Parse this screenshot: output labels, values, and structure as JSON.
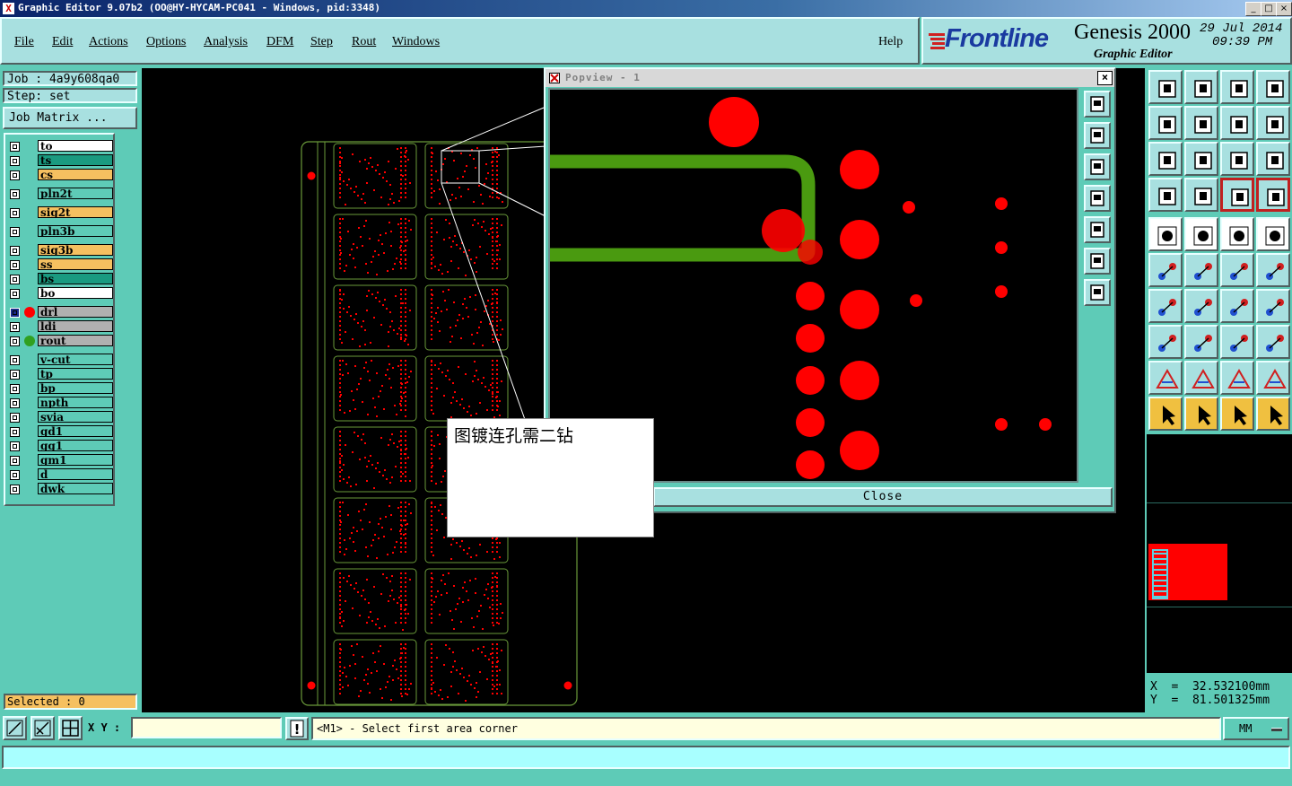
{
  "window": {
    "title": "Graphic Editor 9.07b2 (OO@HY-HYCAM-PC041 - Windows, pid:3348)",
    "controls": [
      "_",
      "□",
      "×"
    ]
  },
  "menu": {
    "items": [
      "File",
      "Edit",
      "Actions",
      "Options",
      "Analysis",
      "DFM",
      "Step",
      "Rout",
      "Windows"
    ],
    "help": "Help"
  },
  "brand": {
    "logo": "Frontline",
    "product": "Genesis 2000",
    "subtitle": "Graphic Editor",
    "date": "29 Jul 2014",
    "time": "09:39 PM"
  },
  "job": {
    "job_label": "Job : 4a9y608qa0",
    "step_label": "Step: set",
    "matrix_button": "Job Matrix ..."
  },
  "layers": [
    {
      "name": "to",
      "color": "#ffffff"
    },
    {
      "name": "ts",
      "color": "#1a9a80"
    },
    {
      "name": "cs",
      "color": "#f5c060"
    },
    {
      "name": "pln2t",
      "color": "#5ecbb7"
    },
    {
      "name": "sig2t",
      "color": "#f5c060"
    },
    {
      "name": "pln3b",
      "color": "#5ecbb7"
    },
    {
      "name": "sig3b",
      "color": "#f5c060"
    },
    {
      "name": "ss",
      "color": "#f5c060"
    },
    {
      "name": "bs",
      "color": "#1a9a80"
    },
    {
      "name": "bo",
      "color": "#ffffff"
    },
    {
      "name": "drl",
      "color": "#b0b0b0",
      "display": "#ff0000"
    },
    {
      "name": "ldi",
      "color": "#b0b0b0"
    },
    {
      "name": "rout",
      "color": "#b0b0b0",
      "display": "#30a020"
    },
    {
      "name": "v-cut",
      "color": "#5ecbb7"
    },
    {
      "name": "tp",
      "color": "#5ecbb7"
    },
    {
      "name": "bp",
      "color": "#5ecbb7"
    },
    {
      "name": "npth",
      "color": "#5ecbb7"
    },
    {
      "name": "svia",
      "color": "#5ecbb7"
    },
    {
      "name": "gd1",
      "color": "#5ecbb7"
    },
    {
      "name": "gg1",
      "color": "#5ecbb7"
    },
    {
      "name": "gm1",
      "color": "#5ecbb7"
    },
    {
      "name": "d",
      "color": "#5ecbb7"
    },
    {
      "name": "dwk",
      "color": "#5ecbb7"
    }
  ],
  "popview": {
    "title": "Popview - 1",
    "close_label": "Close",
    "close_x": "×"
  },
  "note": "图镀连孔需二钻",
  "selected": "Selected : 0",
  "coords": {
    "x": "X  =  32.532100mm",
    "y": "Y  =  81.501325mm"
  },
  "bottom": {
    "xy_label": "X Y :",
    "xy_value": "",
    "message": "<M1> - Select first area corner",
    "units": "MM",
    "command": ""
  },
  "colors": {
    "panel": "#5ecbb7",
    "button": "#a8e0e0",
    "drill": "#ff0000",
    "rout": "#4a9a10",
    "outline": "#6a9a3a"
  }
}
